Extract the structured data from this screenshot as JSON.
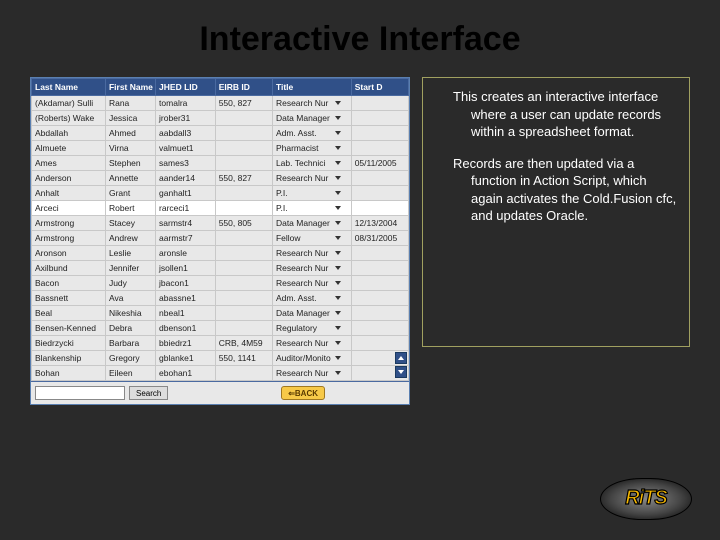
{
  "title": "Interactive Interface",
  "body": {
    "p1": "This creates an interactive interface where a user can update records within a spreadsheet format.",
    "p2": "Records are then updated via a function in Action Script, which again activates the Cold.Fusion cfc, and updates Oracle."
  },
  "table": {
    "headers": [
      "Last Name",
      "First Name",
      "JHED LID",
      "EIRB ID",
      "Title",
      "Start D"
    ],
    "rows": [
      {
        "ln": "(Akdamar) Sulli",
        "fn": "Rana",
        "jhed": "tomalra",
        "eirb": "550, 827",
        "title": "Research Nur",
        "start": ""
      },
      {
        "ln": "(Roberts) Wake",
        "fn": "Jessica",
        "jhed": "jrober31",
        "eirb": "",
        "title": "Data Manager",
        "start": ""
      },
      {
        "ln": "Abdallah",
        "fn": "Ahmed",
        "jhed": "aabdall3",
        "eirb": "",
        "title": "Adm. Asst.",
        "start": ""
      },
      {
        "ln": "Almuete",
        "fn": "Virna",
        "jhed": "valmuet1",
        "eirb": "",
        "title": "Pharmacist",
        "start": ""
      },
      {
        "ln": "Ames",
        "fn": "Stephen",
        "jhed": "sames3",
        "eirb": "",
        "title": "Lab. Technici",
        "start": "05/11/2005"
      },
      {
        "ln": "Anderson",
        "fn": "Annette",
        "jhed": "aander14",
        "eirb": "550, 827",
        "title": "Research Nur",
        "start": ""
      },
      {
        "ln": "Anhalt",
        "fn": "Grant",
        "jhed": "ganhalt1",
        "eirb": "",
        "title": "P.I.",
        "start": ""
      },
      {
        "ln": "Arceci",
        "fn": "Robert",
        "jhed": "rarceci1",
        "eirb": "",
        "title": "P.I.",
        "start": "",
        "highlight": true
      },
      {
        "ln": "Armstrong",
        "fn": "Stacey",
        "jhed": "sarmstr4",
        "eirb": "550, 805",
        "title": "Data Manager",
        "start": "12/13/2004"
      },
      {
        "ln": "Armstrong",
        "fn": "Andrew",
        "jhed": "aarmstr7",
        "eirb": "",
        "title": "Fellow",
        "start": "08/31/2005"
      },
      {
        "ln": "Aronson",
        "fn": "Leslie",
        "jhed": "aronsle",
        "eirb": "",
        "title": "Research Nur",
        "start": ""
      },
      {
        "ln": "Axilbund",
        "fn": "Jennifer",
        "jhed": "jsollen1",
        "eirb": "",
        "title": "Research Nur",
        "start": ""
      },
      {
        "ln": "Bacon",
        "fn": "Judy",
        "jhed": "jbacon1",
        "eirb": "",
        "title": "Research Nur",
        "start": ""
      },
      {
        "ln": "Bassnett",
        "fn": "Ava",
        "jhed": "abassne1",
        "eirb": "",
        "title": "Adm. Asst.",
        "start": ""
      },
      {
        "ln": "Beal",
        "fn": "Nikeshia",
        "jhed": "nbeal1",
        "eirb": "",
        "title": "Data Manager",
        "start": ""
      },
      {
        "ln": "Bensen-Kenned",
        "fn": "Debra",
        "jhed": "dbenson1",
        "eirb": "",
        "title": "Regulatory",
        "start": ""
      },
      {
        "ln": "Biedrzycki",
        "fn": "Barbara",
        "jhed": "bbiedrz1",
        "eirb": "CRB, 4M59",
        "title": "Research Nur",
        "start": ""
      },
      {
        "ln": "Blankenship",
        "fn": "Gregory",
        "jhed": "gblanke1",
        "eirb": "550, 1141",
        "title": "Auditor/Monito",
        "start": ""
      },
      {
        "ln": "Bohan",
        "fn": "Eileen",
        "jhed": "ebohan1",
        "eirb": "",
        "title": "Research Nur",
        "start": ""
      }
    ],
    "search_label": "Search",
    "back_label": "⇐BACK"
  },
  "logo_text": "RiTS"
}
